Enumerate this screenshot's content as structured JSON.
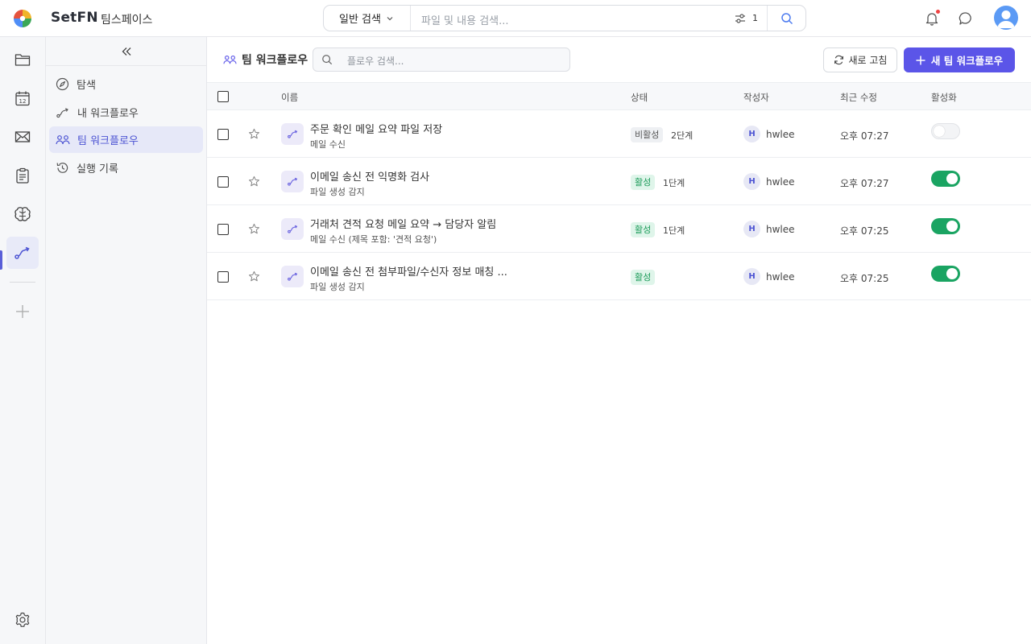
{
  "app": {
    "brand": "SetFN",
    "workspace": "팀스페이스"
  },
  "search": {
    "mode": "일반 검색",
    "placeholder": "파일 및 내용 검색...",
    "filter_count": "1"
  },
  "sidebar": {
    "items": [
      {
        "label": "탐색",
        "icon": "compass-icon"
      },
      {
        "label": "내 워크플로우",
        "icon": "workflow-icon"
      },
      {
        "label": "팀 워크플로우",
        "icon": "team-icon",
        "active": true
      },
      {
        "label": "실행 기록",
        "icon": "history-icon"
      }
    ]
  },
  "main": {
    "title": "팀 워크플로우",
    "search_placeholder": "플로우 검색...",
    "refresh_label": "새로 고침",
    "new_button_label": "새 팀 워크플로우",
    "columns": {
      "name": "이름",
      "status": "상태",
      "author": "작성자",
      "modified": "최근 수정",
      "active": "활성화"
    },
    "rows": [
      {
        "title": "주문 확인 메일 요약 파일 저장",
        "trigger": "메일 수신",
        "status": "비활성",
        "status_type": "inactive",
        "steps": "2단계",
        "author_initial": "H",
        "author": "hwlee",
        "modified": "오후 07:27",
        "enabled": false
      },
      {
        "title": "이메일 송신 전 익명화 검사",
        "trigger": "파일 생성 감지",
        "status": "활성",
        "status_type": "active",
        "steps": "1단계",
        "author_initial": "H",
        "author": "hwlee",
        "modified": "오후 07:27",
        "enabled": true
      },
      {
        "title": "거래처 견적 요청 메일 요약 → 담당자 알림",
        "trigger": "메일 수신 (제목 포함: '견적 요청')",
        "status": "활성",
        "status_type": "active",
        "steps": "1단계",
        "author_initial": "H",
        "author": "hwlee",
        "modified": "오후 07:25",
        "enabled": true
      },
      {
        "title": "이메일 송신 전 첨부파일/수신자 정보 매칭 ...",
        "trigger": "파일 생성 감지",
        "status": "활성",
        "status_type": "active",
        "steps": "",
        "author_initial": "H",
        "author": "hwlee",
        "modified": "오후 07:25",
        "enabled": true
      }
    ]
  },
  "colors": {
    "accent": "#5b55e8",
    "active_green": "#1aa462",
    "badge_active_bg": "#dff5ea",
    "badge_inactive_bg": "#eef0f3"
  }
}
